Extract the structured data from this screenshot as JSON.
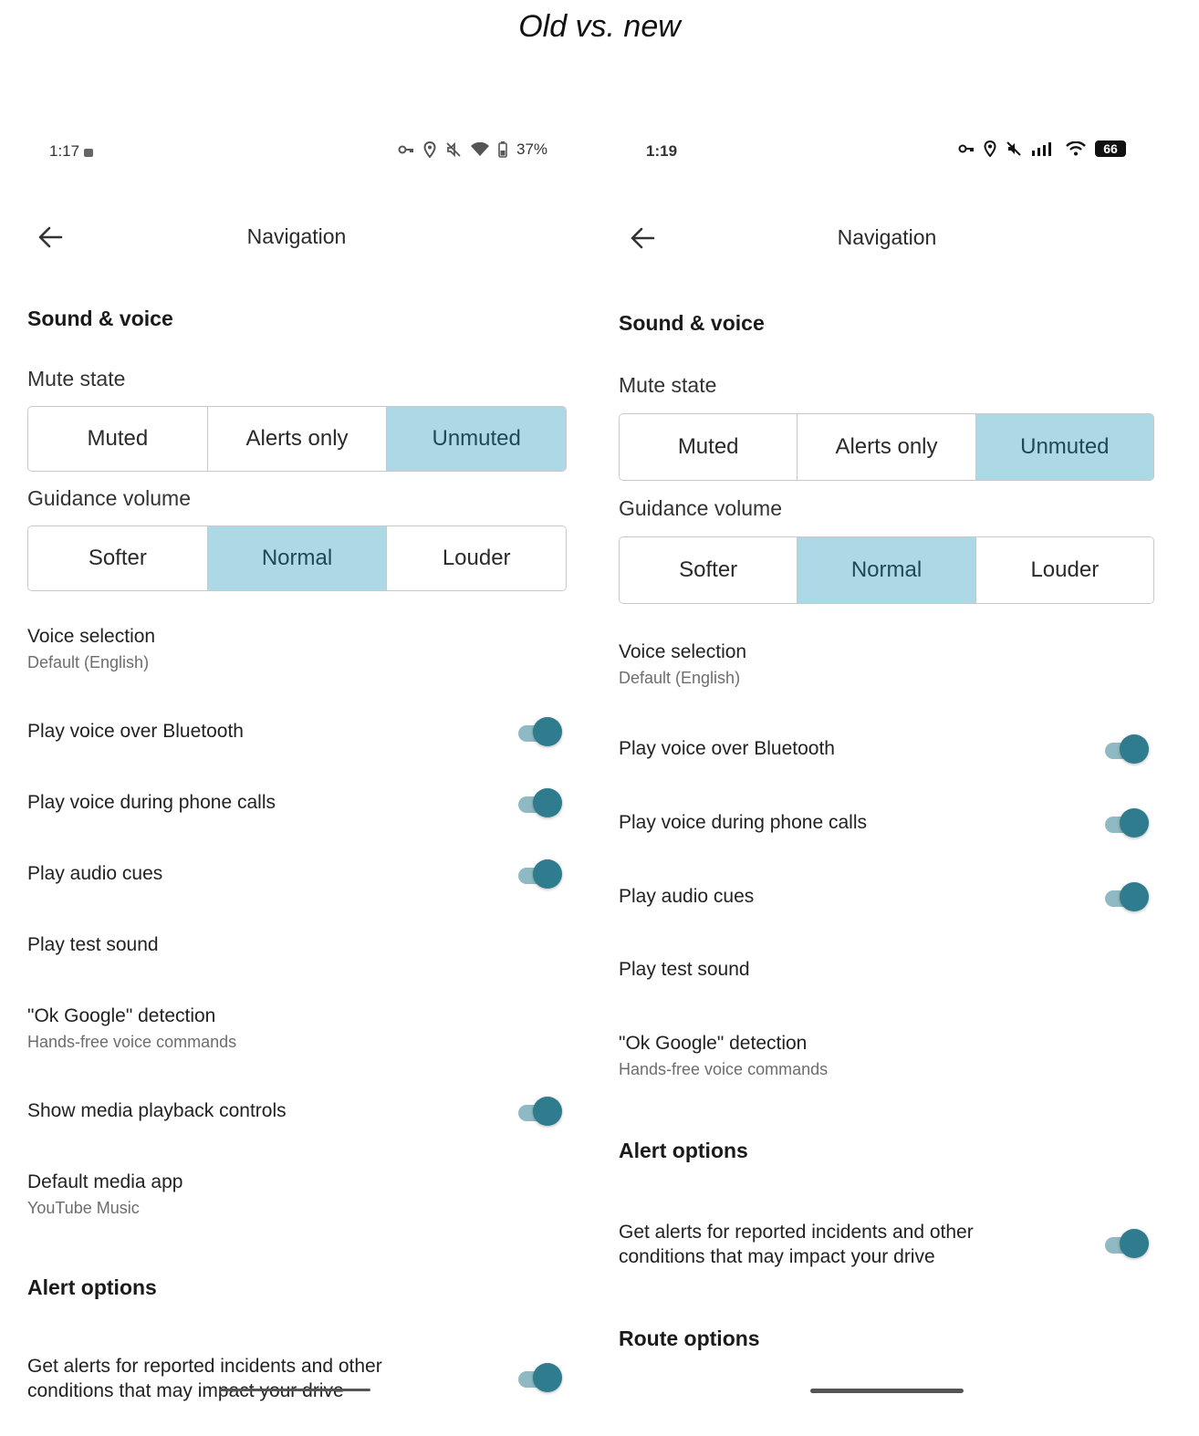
{
  "caption": "Old vs. new",
  "old": {
    "status": {
      "time": "1:17",
      "battery": "37%"
    },
    "title": "Navigation",
    "sound_section": "Sound & voice",
    "mute_label": "Mute state",
    "mute_options": [
      "Muted",
      "Alerts only",
      "Unmuted"
    ],
    "mute_selected": "Unmuted",
    "volume_label": "Guidance volume",
    "volume_options": [
      "Softer",
      "Normal",
      "Louder"
    ],
    "volume_selected": "Normal",
    "voice_selection": {
      "title": "Voice selection",
      "sub": "Default (English)"
    },
    "bluetooth": {
      "title": "Play voice over Bluetooth",
      "on": true
    },
    "phone_calls": {
      "title": "Play voice during phone calls",
      "on": true
    },
    "audio_cues": {
      "title": "Play audio cues",
      "on": true
    },
    "test_sound": {
      "title": "Play test sound"
    },
    "ok_google": {
      "title": "\"Ok Google\" detection",
      "sub": "Hands-free voice commands"
    },
    "media_controls": {
      "title": "Show media playback controls",
      "on": true
    },
    "media_app": {
      "title": "Default media app",
      "sub": "YouTube Music"
    },
    "alert_section": "Alert options",
    "alerts": {
      "line1": "Get alerts for reported incidents and other",
      "line2": "conditions that may impact your drive",
      "on": true
    }
  },
  "new": {
    "status": {
      "time": "1:19",
      "battery": "66"
    },
    "title": "Navigation",
    "sound_section": "Sound & voice",
    "mute_label": "Mute state",
    "mute_options": [
      "Muted",
      "Alerts only",
      "Unmuted"
    ],
    "mute_selected": "Unmuted",
    "volume_label": "Guidance volume",
    "volume_options": [
      "Softer",
      "Normal",
      "Louder"
    ],
    "volume_selected": "Normal",
    "voice_selection": {
      "title": "Voice selection",
      "sub": "Default (English)"
    },
    "bluetooth": {
      "title": "Play voice over Bluetooth",
      "on": true
    },
    "phone_calls": {
      "title": "Play voice during phone calls",
      "on": true
    },
    "audio_cues": {
      "title": "Play audio cues",
      "on": true
    },
    "test_sound": {
      "title": "Play test sound"
    },
    "ok_google": {
      "title": "\"Ok Google\" detection",
      "sub": "Hands-free voice commands"
    },
    "alert_section": "Alert options",
    "alerts": {
      "line1": "Get alerts for reported incidents and other",
      "line2": "conditions that may impact your drive",
      "on": true
    },
    "route_section": "Route options"
  },
  "colors": {
    "selected_segment": "#add8e6",
    "toggle_thumb": "#2f7c8e",
    "toggle_track": "#8fbac4"
  }
}
